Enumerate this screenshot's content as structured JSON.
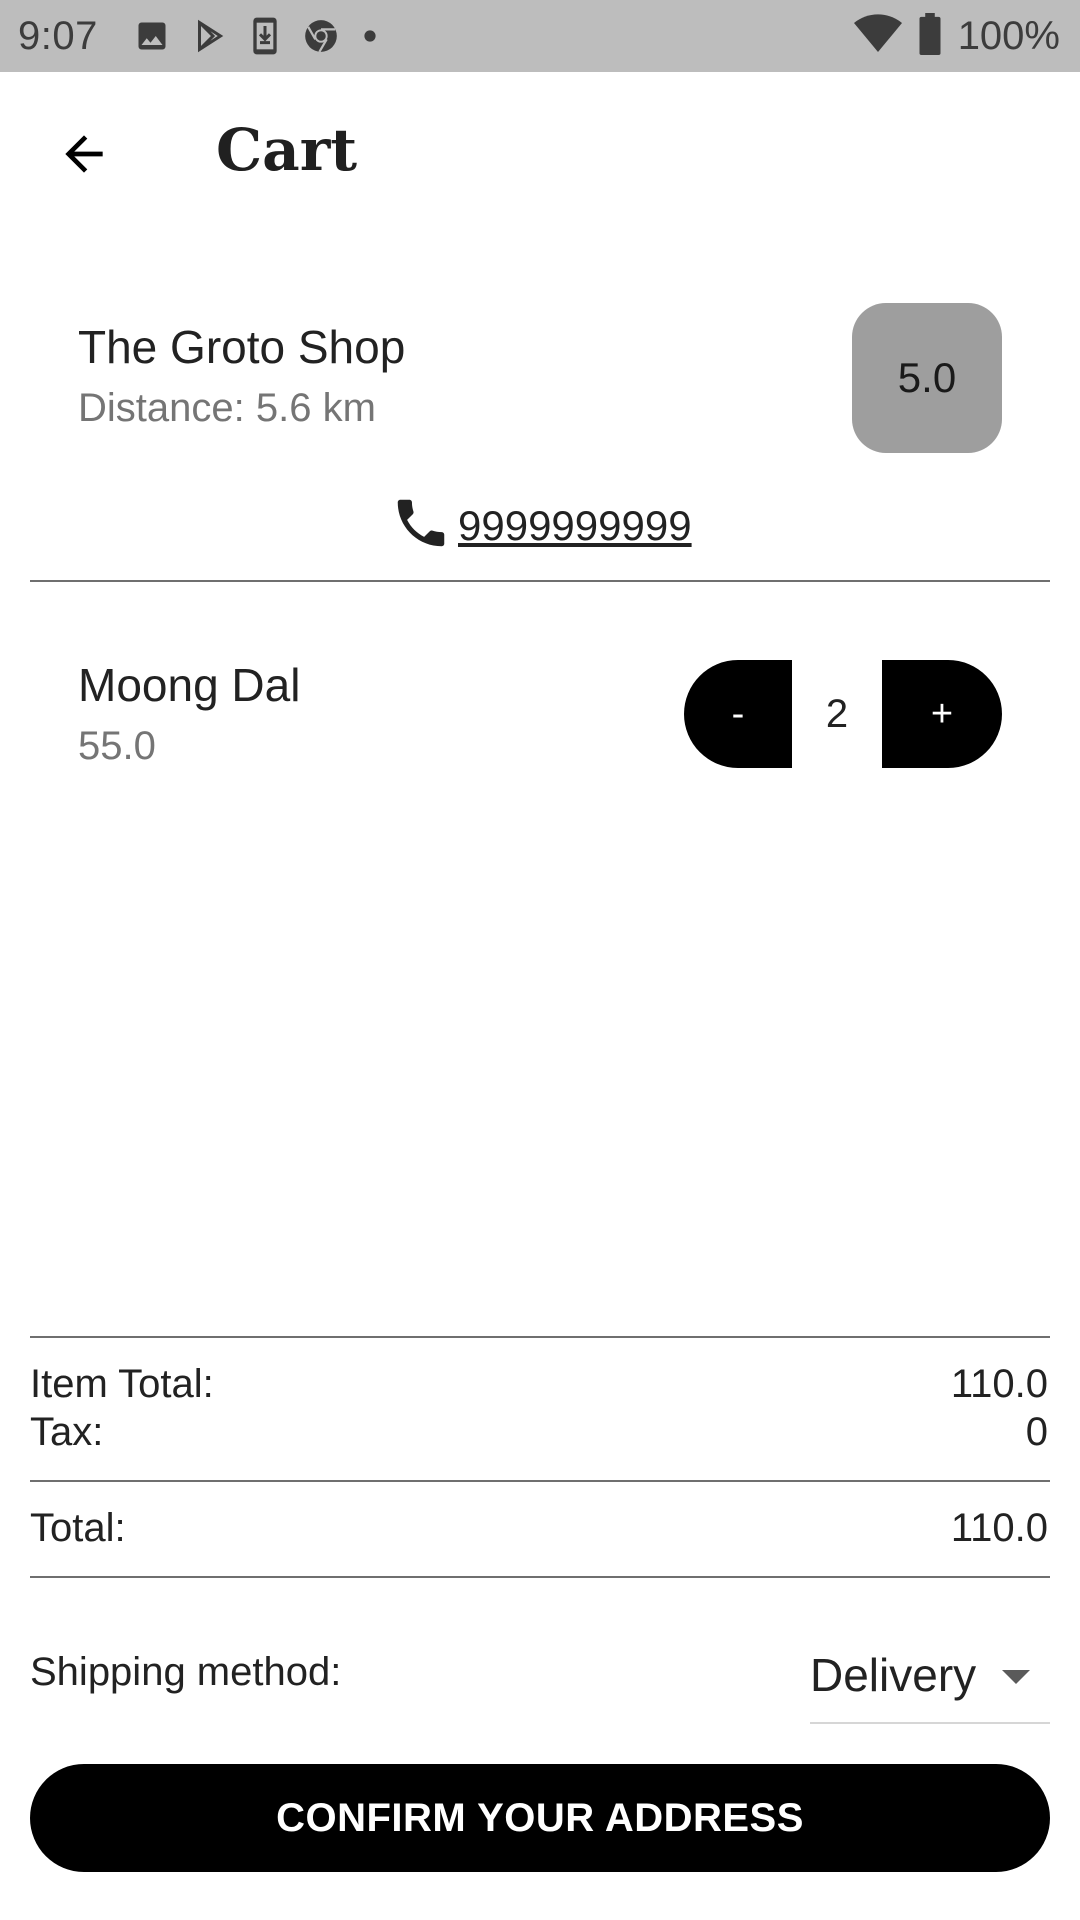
{
  "status_bar": {
    "time": "9:07",
    "battery": "100%",
    "left_icons": [
      "image-icon",
      "play-store-icon",
      "download-icon",
      "chrome-icon",
      "dot-icon"
    ],
    "right_icons": [
      "wifi-icon",
      "battery-icon"
    ]
  },
  "header": {
    "back_icon": "arrow-back-icon",
    "title": "Cart"
  },
  "shop": {
    "name": "The Groto Shop",
    "distance": "Distance: 5.6 km",
    "rating": "5.0",
    "phone": "9999999999",
    "phone_icon": "phone-icon"
  },
  "cart_items": [
    {
      "name": "Moong Dal",
      "price": "55.0",
      "quantity": "2",
      "minus_label": "-",
      "plus_label": "+"
    }
  ],
  "summary": {
    "item_total_label": "Item Total:",
    "item_total_value": "110.0",
    "tax_label": "Tax:",
    "tax_value": "0",
    "total_label": "Total:",
    "total_value": "110.0"
  },
  "shipping": {
    "label": "Shipping method:",
    "selected": "Delivery",
    "caret_icon": "dropdown-caret-icon"
  },
  "confirm_button": "CONFIRM YOUR ADDRESS",
  "colors": {
    "status_bar_bg": "#bdbdbd",
    "rating_badge_bg": "#9e9e9e",
    "button_bg": "#000000",
    "secondary_text": "#757575"
  }
}
